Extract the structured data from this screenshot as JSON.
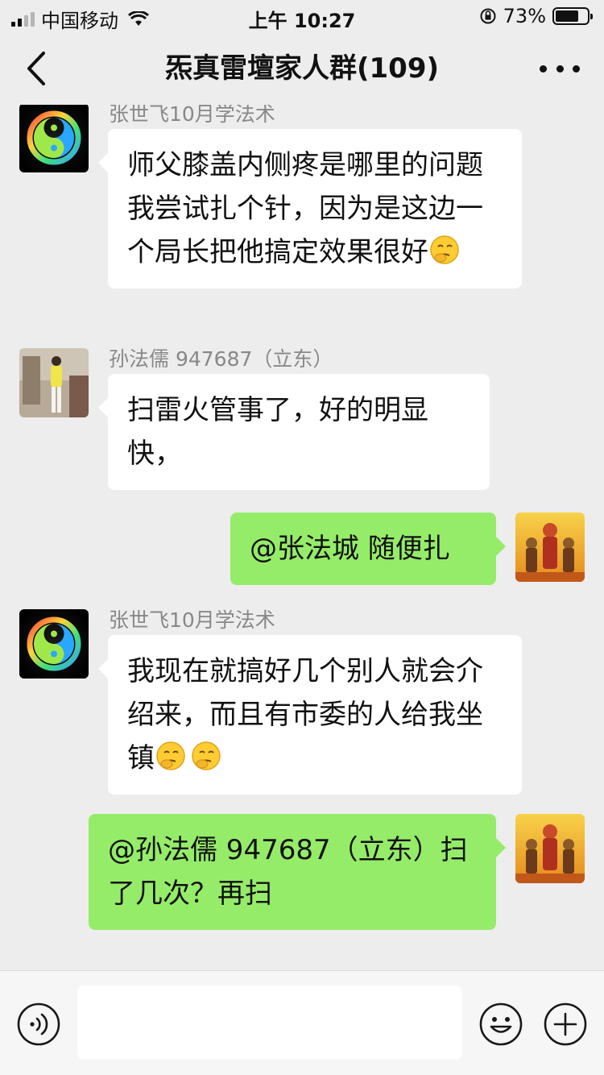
{
  "status": {
    "carrier": "中国移动",
    "time": "上午 10:27",
    "battery": "73%",
    "battery_level": 0.73
  },
  "nav": {
    "title": "炁真雷壇家人群(109)"
  },
  "messages": [
    {
      "direction": "in",
      "sender": "张世飞10月学法术",
      "text": "师父膝盖内侧疼是哪里的问题我尝试扎个针，因为是这边一个局长把他搞定效果很好",
      "emoji_count": 1,
      "avatar": "taiji-avatar"
    },
    {
      "direction": "in",
      "sender": "孙法儒 947687（立东）",
      "text": "扫雷火管事了，好的明显快，",
      "avatar": "person-avatar"
    },
    {
      "direction": "out",
      "text": "@张法城 随便扎",
      "avatar": "deity-avatar"
    },
    {
      "direction": "in",
      "sender": "张世飞10月学法术",
      "text": "我现在就搞好几个别人就会介绍来，而且有市委的人给我坐镇",
      "emoji_count": 2,
      "avatar": "taiji-avatar"
    },
    {
      "direction": "out",
      "text": "@孙法儒 947687（立东）扫了几次？再扫",
      "avatar": "deity-avatar"
    }
  ],
  "input": {
    "value": "",
    "placeholder": ""
  }
}
